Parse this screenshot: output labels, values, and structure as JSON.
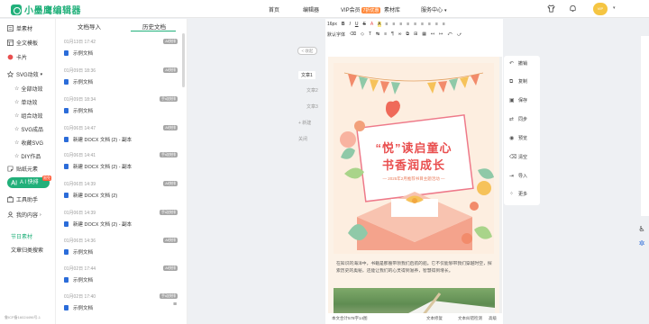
{
  "header": {
    "logo_text": "小墨鹰编辑器",
    "nav": [
      {
        "label": "首页"
      },
      {
        "label": "编辑器"
      },
      {
        "label": "VIP会员",
        "badge": "7折优惠"
      },
      {
        "label": "素材库"
      },
      {
        "label": "服务中心",
        "has_caret": true
      }
    ],
    "avatar_text": "VIP"
  },
  "sidebar": {
    "items": [
      {
        "label": "单素材",
        "icon": "single-material-icon"
      },
      {
        "label": "全文模板",
        "icon": "full-template-icon"
      },
      {
        "label": "卡片",
        "icon": "card-icon"
      },
      {
        "label": "SVG动效",
        "icon": "svg-effect-icon",
        "expanded": true
      }
    ],
    "svg_sub": [
      {
        "label": "全部动效"
      },
      {
        "label": "单动效"
      },
      {
        "label": "组合动效"
      },
      {
        "label": "SVG成品"
      },
      {
        "label": "收藏SVG"
      },
      {
        "label": "DIY作品"
      }
    ],
    "items_after": [
      {
        "label": "贴纸元素",
        "icon": "sticker-icon"
      }
    ],
    "ai": {
      "label": "A I 快排",
      "badge": "限免"
    },
    "items_bottom": [
      {
        "label": "工具助手",
        "icon": "tools-icon"
      },
      {
        "label": "我的内容",
        "icon": "my-content-icon",
        "has_caret": true
      }
    ],
    "links": [
      {
        "label": "节日素材"
      },
      {
        "label": "文章归类搜索"
      }
    ],
    "icp": "鲁ICP备16024496号-1"
  },
  "history": {
    "tabs": [
      {
        "label": "文档导入",
        "active": false
      },
      {
        "label": "历史文档",
        "active": true
      }
    ],
    "rows": [
      {
        "date": "01月13日 17:42",
        "tag": "AI快排",
        "name": "示例文档"
      },
      {
        "date": "01月09日 18:36",
        "tag": "AI快排",
        "name": "示例文档"
      },
      {
        "date": "01月09日 18:34",
        "tag": "手动快排",
        "name": "示例文档"
      },
      {
        "date": "01月06日 14:47",
        "tag": "AI快排",
        "name": "新建 DOCX 文档 (2) - 副本"
      },
      {
        "date": "01月06日 14:41",
        "tag": "手动快排",
        "name": "新建 DOCX 文档 (2) - 副本"
      },
      {
        "date": "01月06日 14:39",
        "tag": "AI快排",
        "name": "新建 DOCX 文档 (2)"
      },
      {
        "date": "01月06日 14:39",
        "tag": "手动快排",
        "name": "新建 DOCX 文档 (2) - 副本"
      },
      {
        "date": "01月06日 14:36",
        "tag": "AI快排",
        "name": "示例文档"
      },
      {
        "date": "01月02日 17:44",
        "tag": "AI快排",
        "name": "示例文档"
      },
      {
        "date": "01月02日 17:40",
        "tag": "手动快排",
        "name": "示例文档"
      }
    ]
  },
  "floating_docs": {
    "collapse_label": "< 收起",
    "items": [
      {
        "label": "文章1",
        "active": true
      },
      {
        "label": "文章2",
        "active": false
      },
      {
        "label": "文章3",
        "active": false
      },
      {
        "label": "+ 新建",
        "active": false
      },
      {
        "label": "关闭",
        "active": false
      }
    ]
  },
  "editor": {
    "toolbar_row1": {
      "font_size": "16px",
      "items": [
        "B",
        "I",
        "U",
        "S",
        "A",
        "A",
        "≡",
        "≡",
        "≡",
        "≡",
        "≡",
        "≡",
        "≡",
        "≡",
        "≡"
      ]
    },
    "toolbar_row2": {
      "font_family": "默认字体",
      "items": [
        "⌫",
        "◇",
        "T",
        "↹",
        "≡",
        "¶",
        "∞",
        "⧉",
        "⊞",
        "▦",
        "↤",
        "↦",
        "⤺",
        "⤻"
      ]
    },
    "poster": {
      "title_line1": "“悦”读启童心",
      "title_line2": "书香润成长",
      "subtitle": "— 2025年2月推荐书目主题活动 —"
    },
    "body_text": "在知识的海洋中，书籍是那艘带领我们启航的船。它不仅能够带我们穿越时空，探索历史的奥秘，还能让我们的心灵得到滋养，智慧得到增长。",
    "status": {
      "word_count": "本文合计578字14图",
      "left_label": "文本修复",
      "middle_label": "文本纠错检测",
      "right_label": "高级"
    }
  },
  "tools": {
    "items": [
      {
        "label": "撤销",
        "icon": "undo-icon"
      },
      {
        "label": "复制",
        "icon": "copy-icon"
      },
      {
        "label": "保存",
        "icon": "save-icon"
      },
      {
        "label": "同步",
        "icon": "sync-icon"
      },
      {
        "label": "预览",
        "icon": "preview-icon"
      },
      {
        "label": "清空",
        "icon": "clear-icon"
      },
      {
        "label": "导入",
        "icon": "import-icon"
      },
      {
        "label": "更多",
        "icon": "more-icon"
      }
    ]
  },
  "colors": {
    "brand": "#21b07a",
    "accent": "#ff8a3d",
    "title_red": "#e94f4f"
  }
}
